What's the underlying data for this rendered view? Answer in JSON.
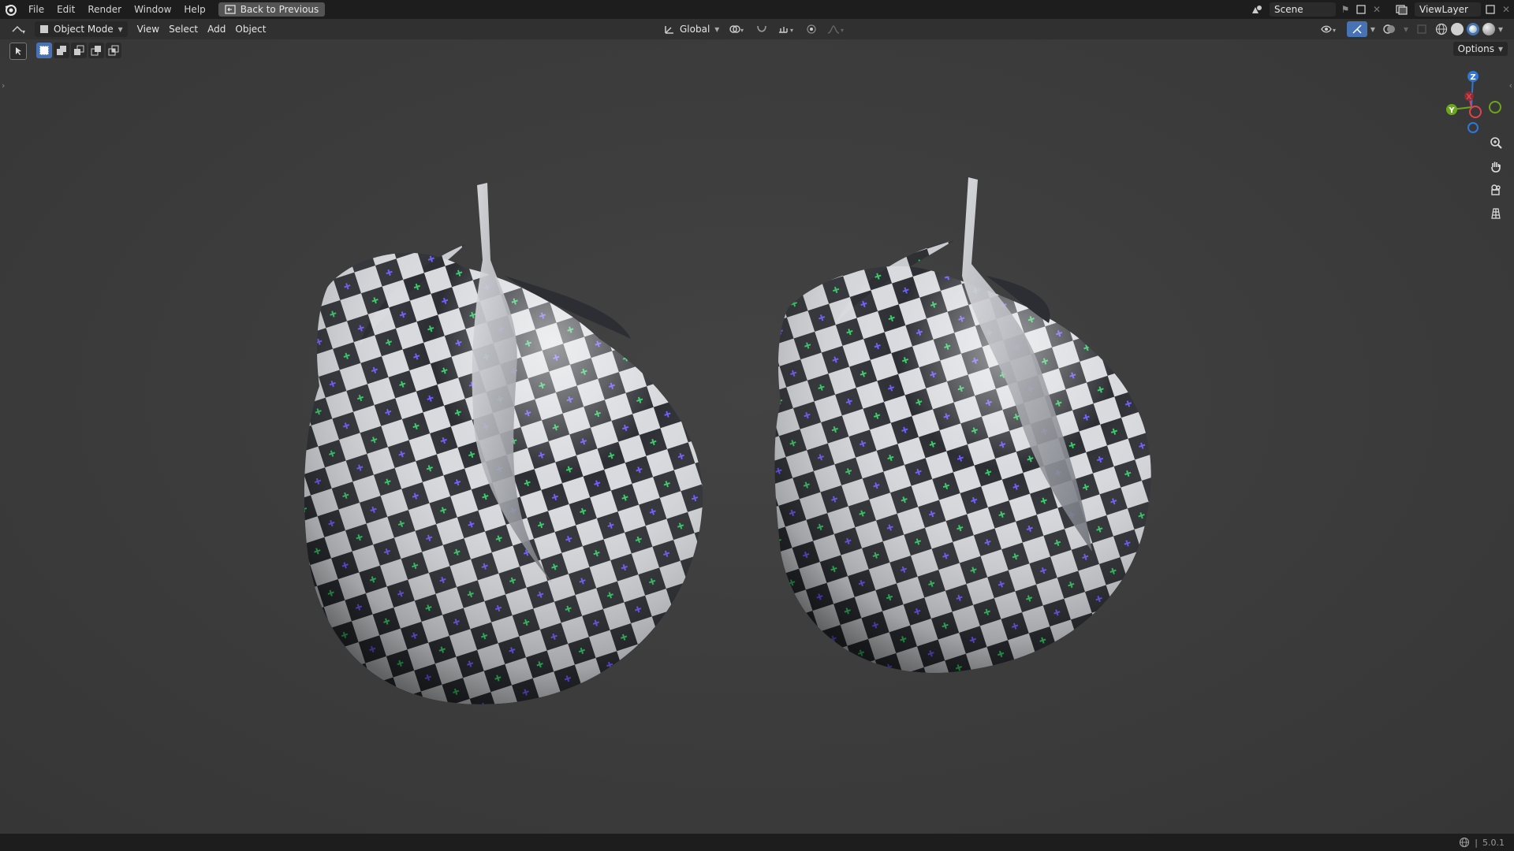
{
  "topbar": {
    "menus": [
      "File",
      "Edit",
      "Render",
      "Window",
      "Help"
    ],
    "back_button": "Back to Previous",
    "scene_name": "Scene",
    "view_layer": "ViewLayer"
  },
  "header": {
    "mode": "Object Mode",
    "menus": [
      "View",
      "Select",
      "Add",
      "Object"
    ],
    "orientation": "Global",
    "options_label": "Options"
  },
  "gizmo": {
    "z": "Z",
    "x": "X",
    "y": "Y"
  },
  "status": {
    "version": "5.0.1"
  },
  "colors": {
    "accent": "#4772b3",
    "axis_x": "#e0424f",
    "axis_y": "#6ca61b",
    "axis_z": "#2f77d8"
  }
}
